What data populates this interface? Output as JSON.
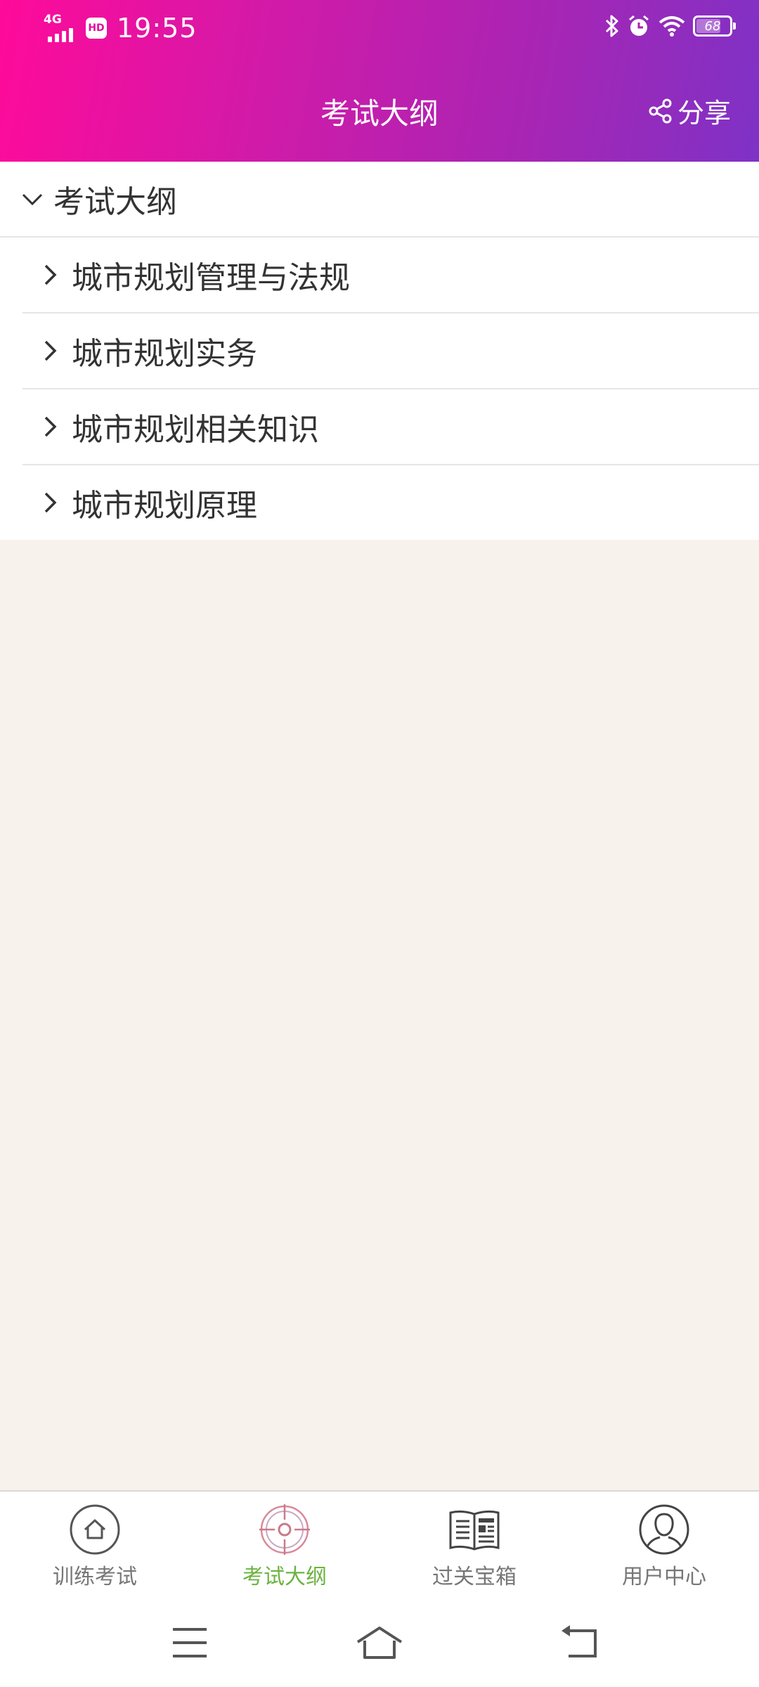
{
  "status_bar": {
    "network": "4G",
    "hd": "HD",
    "time": "19:55",
    "battery": "68"
  },
  "header": {
    "title": "考试大纲",
    "share_label": "分享"
  },
  "outline": {
    "root": {
      "label": "考试大纲",
      "expanded": true
    },
    "items": [
      {
        "label": "城市规划管理与法规"
      },
      {
        "label": "城市规划实务"
      },
      {
        "label": "城市规划相关知识"
      },
      {
        "label": "城市规划原理"
      }
    ]
  },
  "tabbar": {
    "active_color": "#6cb33f",
    "tabs": [
      {
        "label": "训练考试",
        "icon": "home-icon",
        "active": false
      },
      {
        "label": "考试大纲",
        "icon": "target-icon",
        "active": true
      },
      {
        "label": "过关宝箱",
        "icon": "newspaper-icon",
        "active": false
      },
      {
        "label": "用户中心",
        "icon": "user-icon",
        "active": false
      }
    ]
  },
  "colors": {
    "header_gradient_start": "#ff0a9a",
    "header_gradient_end": "#7e32c6",
    "page_background": "#f7f3ec"
  }
}
